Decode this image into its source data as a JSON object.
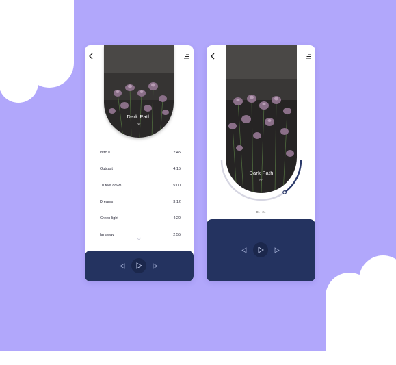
{
  "album": {
    "title": "Dark Path",
    "artist": "NF"
  },
  "tracks": [
    {
      "name": "intro ii",
      "duration": "2:45"
    },
    {
      "name": "Outcast",
      "duration": "4:15"
    },
    {
      "name": "10 feet down",
      "duration": "5:00"
    },
    {
      "name": "Dreams",
      "duration": "3:12"
    },
    {
      "name": "Green light",
      "duration": "4:20"
    },
    {
      "name": "far away",
      "duration": "2:55"
    }
  ],
  "now_playing": {
    "position": "01 : 24",
    "progress": 0.7
  },
  "colors": {
    "background": "#b1a7fb",
    "player": "#243360",
    "accent": "#2b3a6a"
  },
  "icons": [
    "back-icon",
    "menu-icon",
    "previous-icon",
    "play-icon",
    "next-icon",
    "chevron-down-icon"
  ]
}
